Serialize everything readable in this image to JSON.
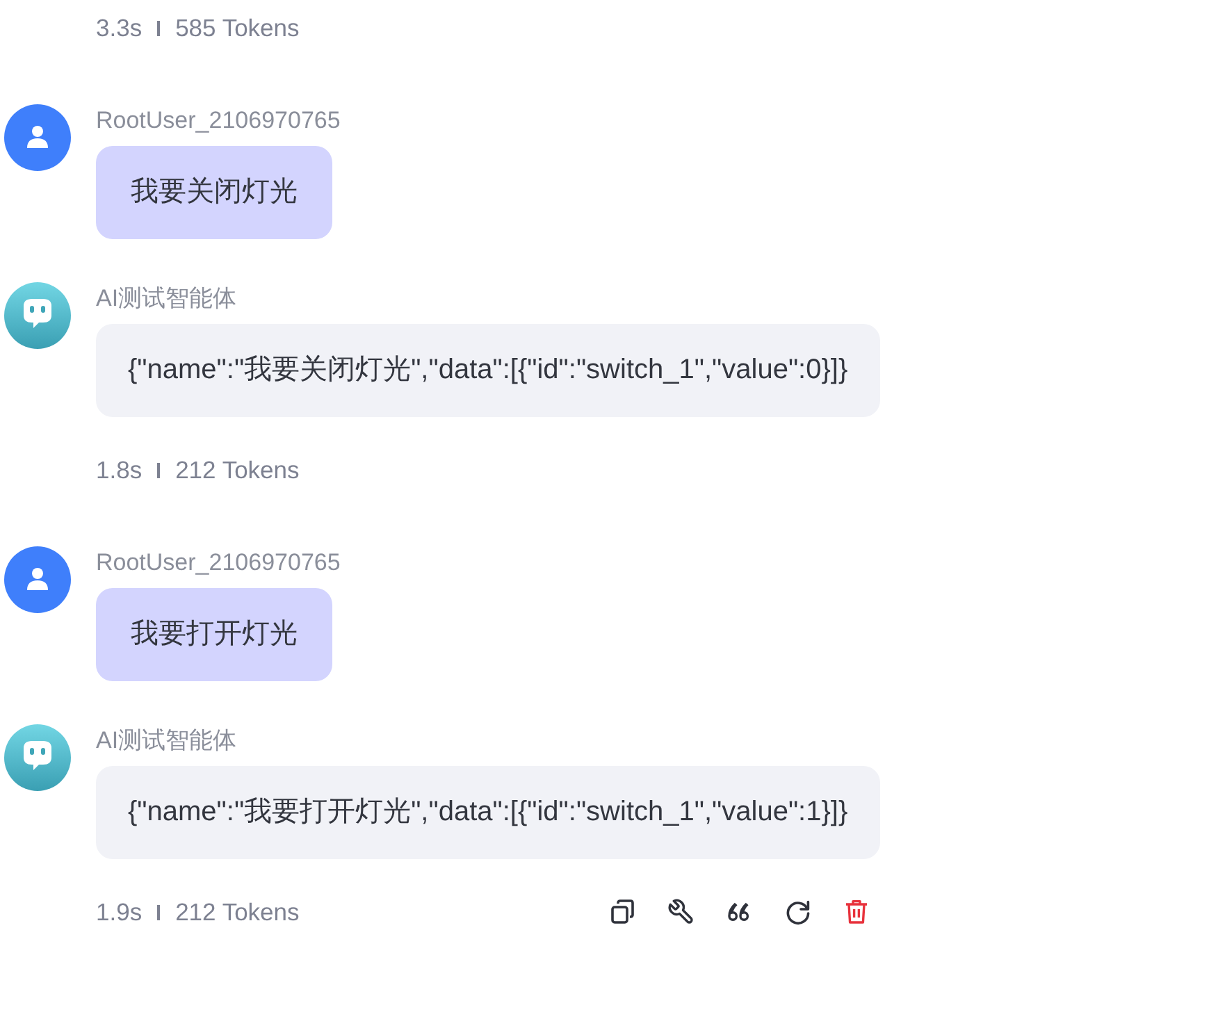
{
  "messages": [
    {
      "kind": "assistant",
      "meta": {
        "time": "3.3s",
        "tokens": "585 Tokens"
      }
    },
    {
      "kind": "user",
      "sender": "RootUser_2106970765",
      "text": "我要关闭灯光"
    },
    {
      "kind": "assistant",
      "sender": "AI测试智能体",
      "text": "{\"name\":\"我要关闭灯光\",\"data\":[{\"id\":\"switch_1\",\"value\":0}]}",
      "meta": {
        "time": "1.8s",
        "tokens": "212 Tokens"
      }
    },
    {
      "kind": "user",
      "sender": "RootUser_2106970765",
      "text": "我要打开灯光"
    },
    {
      "kind": "assistant",
      "sender": "AI测试智能体",
      "text": "{\"name\":\"我要打开灯光\",\"data\":[{\"id\":\"switch_1\",\"value\":1}]}",
      "meta": {
        "time": "1.9s",
        "tokens": "212 Tokens"
      },
      "actions": [
        {
          "kind": "copy"
        },
        {
          "kind": "tools"
        },
        {
          "kind": "quote"
        },
        {
          "kind": "regenerate"
        },
        {
          "kind": "delete"
        }
      ]
    }
  ]
}
